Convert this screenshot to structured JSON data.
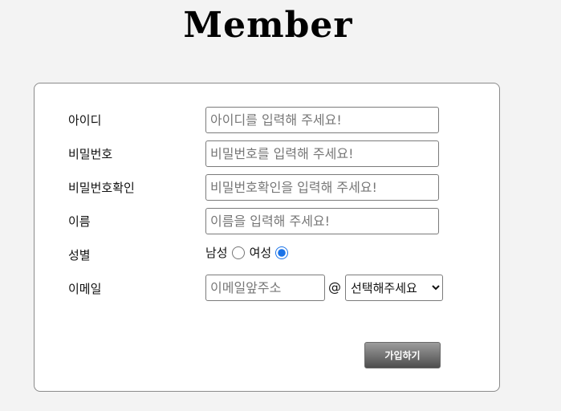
{
  "page": {
    "title": "Member"
  },
  "form": {
    "fields": [
      {
        "label": "아이디",
        "placeholder": "아이디를 입력해 주세요!"
      },
      {
        "label": "비밀번호",
        "placeholder": "비밀번호를 입력해 주세요!"
      },
      {
        "label": "비밀번호확인",
        "placeholder": "비밀번호확인을 입력해 주세요!"
      },
      {
        "label": "이름",
        "placeholder": "이름을 입력해 주세요!"
      }
    ],
    "gender": {
      "label": "성별",
      "options": [
        {
          "label": "남성",
          "checked": false
        },
        {
          "label": "여성",
          "checked": true
        }
      ]
    },
    "email": {
      "label": "이메일",
      "placeholder": "이메일앞주소",
      "at": "@",
      "domain_selected": "선택해주세요"
    },
    "submit_label": "가입하기"
  },
  "colors": {
    "radio_accent": "#1a73e8",
    "card_border": "#8a8a8a",
    "button_gradient_top": "#9c9c9c",
    "button_gradient_bottom": "#4d4d4d"
  }
}
